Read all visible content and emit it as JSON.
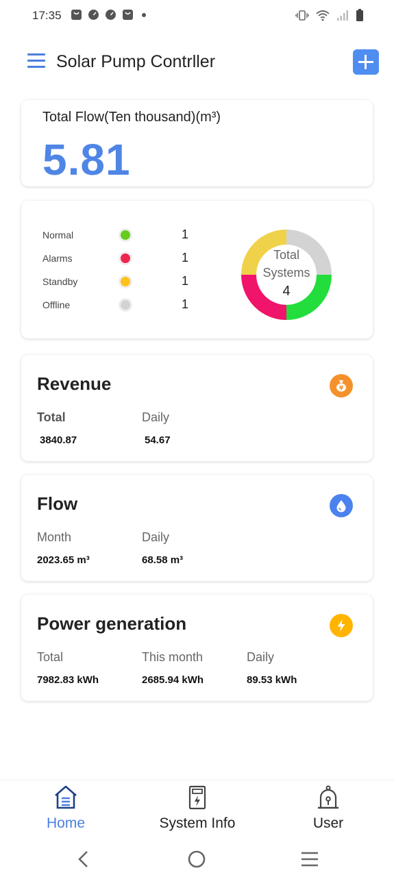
{
  "status_bar": {
    "time": "17:35",
    "left_icons": [
      "bag-icon",
      "gauge-icon",
      "gauge-icon",
      "bag-icon",
      "dot-icon"
    ],
    "right_icons": [
      "vibrate-icon",
      "wifi-icon",
      "signal-icon",
      "battery-icon"
    ]
  },
  "app_bar": {
    "title": "Solar Pump Contrller",
    "menu_icon": "hamburger-menu-icon",
    "add_icon": "plus-icon"
  },
  "total_flow": {
    "label": "Total Flow(Ten thousand)(m³)",
    "value": "5.81"
  },
  "system_status": {
    "items": [
      {
        "label": "Normal",
        "count": "1",
        "color": "#66cc1f"
      },
      {
        "label": "Alarms",
        "count": "1",
        "color": "#f0264f"
      },
      {
        "label": "Standby",
        "count": "1",
        "color": "#ffc21a"
      },
      {
        "label": "Offline",
        "count": "1",
        "color": "#d3d3d3"
      }
    ],
    "donut": {
      "line1": "Total",
      "line2": "Systems",
      "total": "4",
      "segments": [
        {
          "name": "Offline",
          "value": 1,
          "color": "#d3d3d3"
        },
        {
          "name": "Normal",
          "value": 1,
          "color": "#22dd3c"
        },
        {
          "name": "Alarms",
          "value": 1,
          "color": "#f0146b"
        },
        {
          "name": "Standby",
          "value": 1,
          "color": "#f0d24a"
        }
      ]
    }
  },
  "revenue": {
    "title": "Revenue",
    "icon": "money-bag-icon",
    "icon_color": "#f5912a",
    "columns": [
      {
        "label": "Total",
        "value": "3840.87"
      },
      {
        "label": "Daily",
        "value": "54.67"
      }
    ]
  },
  "flow": {
    "title": "Flow",
    "icon": "water-drop-icon",
    "icon_color": "#4c82ee",
    "columns": [
      {
        "label": "Month",
        "value": "2023.65 m³"
      },
      {
        "label": "Daily",
        "value": "68.58 m³"
      }
    ]
  },
  "power": {
    "title": "Power generation",
    "icon": "lightning-icon",
    "icon_color": "#ffb400",
    "columns": [
      {
        "label": "Total",
        "value": "7982.83 kWh"
      },
      {
        "label": "This month",
        "value": "2685.94 kWh"
      },
      {
        "label": "Daily",
        "value": "89.53 kWh"
      }
    ]
  },
  "bottom_nav": {
    "items": [
      {
        "label": "Home",
        "icon": "home-icon",
        "active": true
      },
      {
        "label": "System Info",
        "icon": "system-info-icon",
        "active": false
      },
      {
        "label": "User",
        "icon": "user-icon",
        "active": false
      }
    ]
  },
  "system_nav": [
    "back-icon",
    "home-circle-icon",
    "recents-icon"
  ]
}
